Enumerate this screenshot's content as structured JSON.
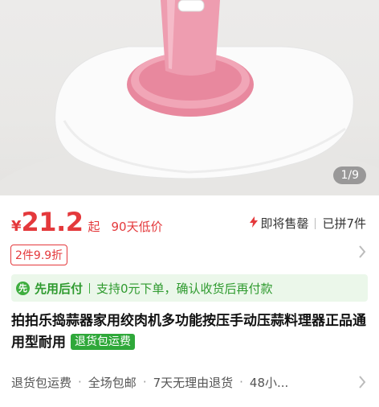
{
  "gallery": {
    "page_indicator": "1/9"
  },
  "price": {
    "currency": "¥",
    "amount": "21.2",
    "suffix": "起",
    "low_label": "90天低价",
    "stock_status": "即将售罄",
    "sold_count": "已拼7件"
  },
  "coupon": {
    "tag": "2件9.9折"
  },
  "payment": {
    "icon_text": "先",
    "label": "先用后付",
    "detail": "支持0元下单，确认收货后再付款"
  },
  "product": {
    "title": "拍拍乐捣蒜器家用绞肉机多功能按压手动压蒜料理器正品通用型耐用",
    "badge": "退货包运费"
  },
  "services": [
    "退货包运费",
    "全场包邮",
    "7天无理由退货",
    "48小..."
  ],
  "colors": {
    "accent_red": "#e4393c",
    "pay_green": "#2fa83a",
    "pay_bg": "#ebf7ea",
    "product_pink": "#e8889e"
  },
  "icons": [
    "bolt-icon",
    "pay-later-icon",
    "chevron-right-icon"
  ]
}
